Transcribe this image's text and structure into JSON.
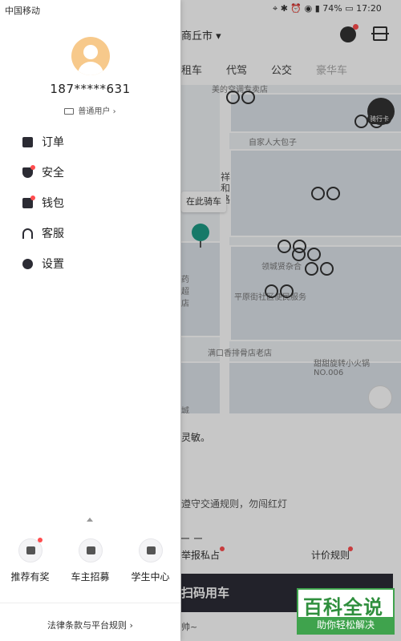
{
  "status_bar": {
    "carrier": "中国移动",
    "battery": "74%",
    "time": "17:20"
  },
  "user": {
    "phone": "187*****631",
    "type": "普通用户"
  },
  "menu": [
    {
      "label": "订单",
      "icon": "order-icon",
      "badge": false
    },
    {
      "label": "安全",
      "icon": "shield-icon",
      "badge": true
    },
    {
      "label": "钱包",
      "icon": "wallet-icon",
      "badge": true
    },
    {
      "label": "客服",
      "icon": "headset-icon",
      "badge": false
    },
    {
      "label": "设置",
      "icon": "gear-icon",
      "badge": false
    }
  ],
  "shortcuts": [
    {
      "label": "推荐有奖",
      "icon": "gift-icon",
      "badge": true
    },
    {
      "label": "车主招募",
      "icon": "driver-icon",
      "badge": false
    },
    {
      "label": "学生中心",
      "icon": "graduation-cap-icon",
      "badge": false
    }
  ],
  "legal": "法律条款与平台规则",
  "background_app": {
    "city": "商丘市",
    "tabs": [
      "租车",
      "代驾",
      "公交",
      "豪华车"
    ],
    "map_labels": [
      "美的空调专卖店",
      "自家人大包子",
      "祥和路",
      "领城贤杂合",
      "平原街社区便民服务",
      "满口香排骨店老店",
      "甜甜旋转小火锅NO.006",
      "药超店",
      "城"
    ],
    "ride_here": "在此骑车",
    "ride_card": "骑行卡",
    "notice": "灵敏。",
    "tip": "遵守交通规则，勿闯红灯",
    "link_report": "举报私占",
    "link_pricing": "计价规则",
    "scan_button": "扫码用车",
    "bottom_note": "帅~"
  },
  "watermark": {
    "title": "百科全说",
    "subtitle": "助你轻松解决"
  },
  "colors": {
    "accent_red": "#ff4d4f",
    "pin_green": "#1e9c86",
    "dark_button": "#2c2c36",
    "avatar": "#f7c98b"
  }
}
